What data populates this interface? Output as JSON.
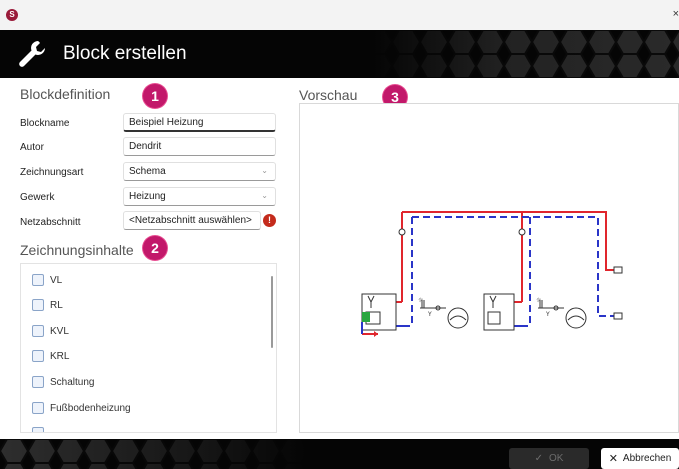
{
  "window": {
    "app_icon_text": "S",
    "close_glyph": "×"
  },
  "header": {
    "title": "Block erstellen",
    "icon": "wrench-icon"
  },
  "sections": {
    "blockdefinition": "Blockdefinition",
    "zeichnungsinhalte": "Zeichnungsinhalte",
    "vorschau": "Vorschau"
  },
  "badges": {
    "one": "1",
    "two": "2",
    "three": "3"
  },
  "form": {
    "blockname": {
      "label": "Blockname",
      "value": "Beispiel Heizung"
    },
    "autor": {
      "label": "Autor",
      "value": "Dendrit"
    },
    "zeichnungsart": {
      "label": "Zeichnungsart",
      "value": "Schema"
    },
    "gewerk": {
      "label": "Gewerk",
      "value": "Heizung"
    },
    "netzabschnitt": {
      "label": "Netzabschnitt",
      "value": "<Netzabschnitt auswählen>",
      "warning": "!"
    }
  },
  "checklist": [
    "VL",
    "RL",
    "KVL",
    "KRL",
    "Schaltung",
    "Fußbodenheizung"
  ],
  "footer": {
    "ok_label": "OK",
    "cancel_label": "Abbrechen"
  },
  "colors": {
    "accent_badge": "#c2186a",
    "header_bg": "#050505",
    "supply_line": "#e0262d",
    "return_line": "#2a35c8",
    "warning": "#c42b1c"
  }
}
